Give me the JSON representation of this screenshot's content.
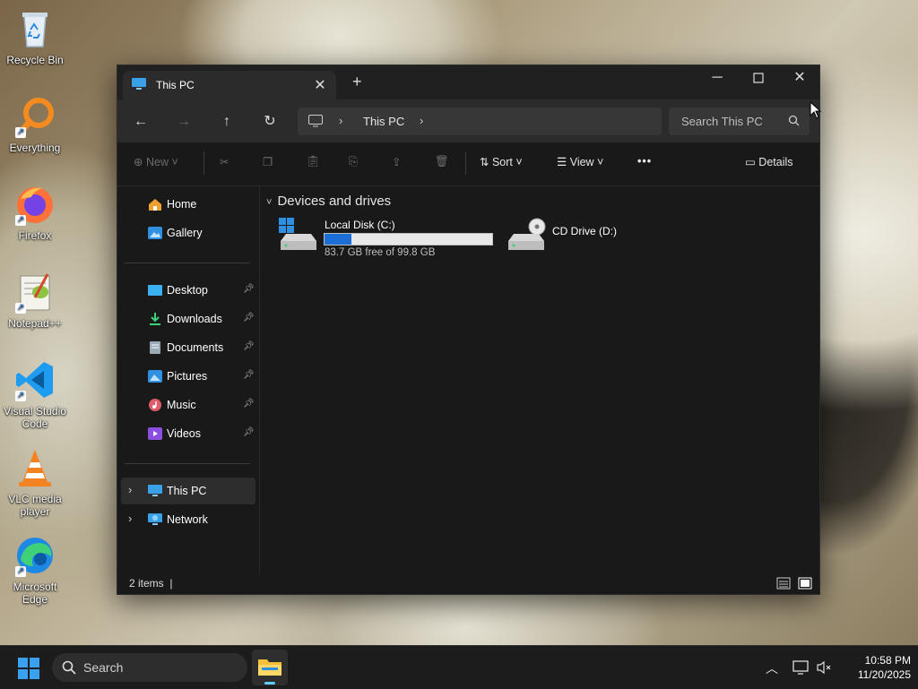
{
  "desktop": {
    "icons": [
      {
        "label": "Recycle Bin"
      },
      {
        "label": "Everything"
      },
      {
        "label": "Firefox"
      },
      {
        "label": "Notepad++"
      },
      {
        "label": "Visual Studio Code"
      },
      {
        "label": "VLC media player"
      },
      {
        "label": "Microsoft Edge"
      }
    ]
  },
  "window": {
    "tab_title": "This PC",
    "address": {
      "crumb": "This PC"
    },
    "search": {
      "placeholder": "Search This PC"
    },
    "toolbar": {
      "new_label": "New",
      "sort_label": "Sort",
      "view_label": "View",
      "more_label": "•••",
      "details_label": "Details"
    },
    "sidebar": {
      "top": [
        {
          "label": "Home",
          "icon": "home-icon"
        },
        {
          "label": "Gallery",
          "icon": "gallery-icon"
        }
      ],
      "pinned": [
        {
          "label": "Desktop",
          "icon": "desktop-folder-icon"
        },
        {
          "label": "Downloads",
          "icon": "downloads-icon"
        },
        {
          "label": "Documents",
          "icon": "documents-icon"
        },
        {
          "label": "Pictures",
          "icon": "pictures-icon"
        },
        {
          "label": "Music",
          "icon": "music-icon"
        },
        {
          "label": "Videos",
          "icon": "videos-icon"
        }
      ],
      "bottom": [
        {
          "label": "This PC",
          "icon": "this-pc-icon"
        },
        {
          "label": "Network",
          "icon": "network-icon"
        }
      ]
    },
    "content": {
      "group_title": "Devices and drives",
      "drives": [
        {
          "name": "Local Disk (C:)",
          "free_text": "83.7 GB free of 99.8 GB",
          "used_fraction": 0.161
        },
        {
          "name": "CD Drive (D:)"
        }
      ]
    },
    "status": {
      "items_text": "2 items"
    }
  },
  "taskbar": {
    "search_placeholder": "Search",
    "time": "10:58 PM",
    "date": "11/20/2025"
  },
  "colors": {
    "accent": "#1c6fd6",
    "window_bg": "#191919",
    "taskbar_bg": "#1c1c1c"
  }
}
